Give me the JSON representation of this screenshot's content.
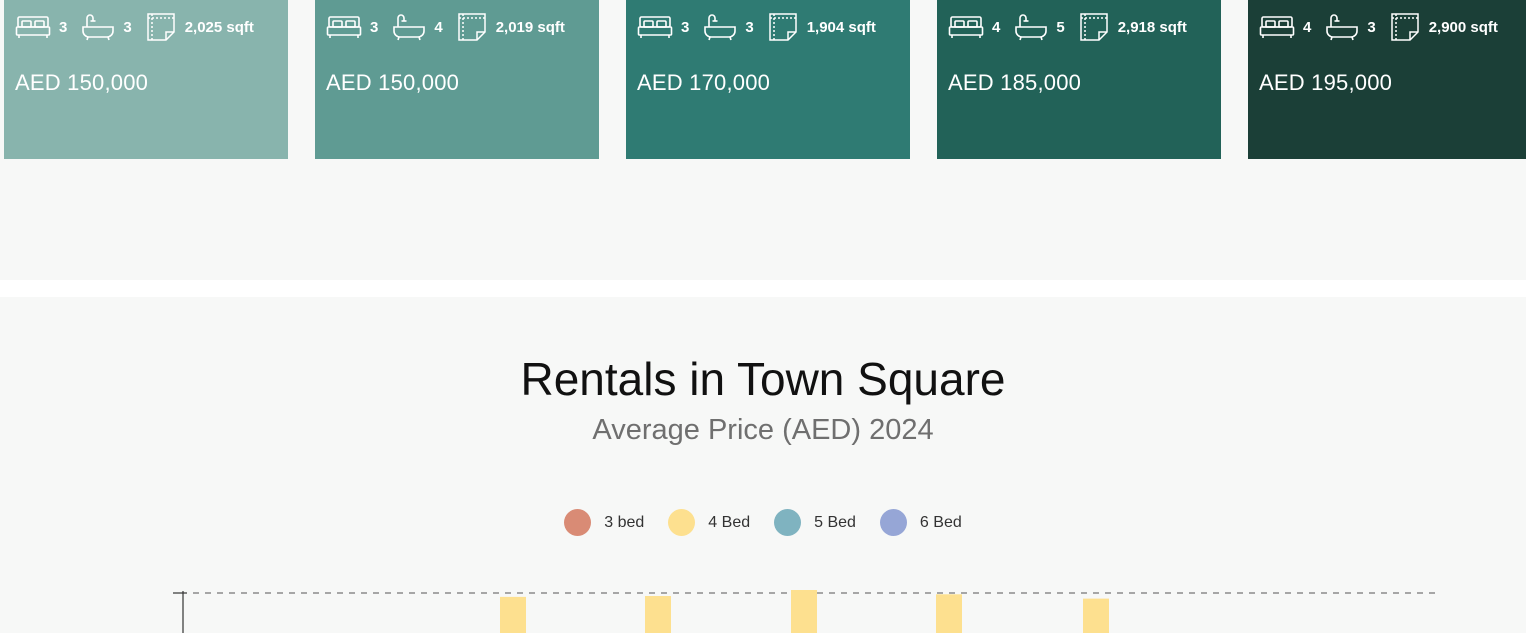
{
  "listings": [
    {
      "beds": "3",
      "baths": "3",
      "area": "2,025 sqft",
      "price": "AED 150,000",
      "color": "#88b4ad"
    },
    {
      "beds": "3",
      "baths": "4",
      "area": "2,019 sqft",
      "price": "AED 150,000",
      "color": "#5f9b93"
    },
    {
      "beds": "3",
      "baths": "3",
      "area": "1,904 sqft",
      "price": "AED 170,000",
      "color": "#2f7b73"
    },
    {
      "beds": "4",
      "baths": "5",
      "area": "2,918 sqft",
      "price": "AED 185,000",
      "color": "#226258"
    },
    {
      "beds": "4",
      "baths": "3",
      "area": "2,900 sqft",
      "price": "AED 195,000",
      "color": "#1b3f37"
    }
  ],
  "icons": {
    "beds": "bed-icon",
    "baths": "bathtub-icon",
    "area": "floor-plan-icon"
  },
  "chart": {
    "title": "Rentals in Town Square",
    "subtitle": "Average Price (AED) 2024"
  },
  "chart_data": {
    "type": "bar",
    "title": "Rentals in Town Square",
    "subtitle": "Average Price (AED) 2024",
    "legend": "top-center",
    "grid": true,
    "series": [
      {
        "name": "3 bed",
        "color": "#d98b75",
        "values": [
          null,
          null,
          null,
          null,
          null,
          null,
          null
        ]
      },
      {
        "name": "4 Bed",
        "color": "#fde08f",
        "values": [
          null,
          null,
          0.84,
          0.86,
          1.0,
          0.9,
          0.8
        ]
      },
      {
        "name": "5 Bed",
        "color": "#7fb3c0",
        "values": [
          null,
          null,
          null,
          null,
          null,
          null,
          null
        ]
      },
      {
        "name": "6 Bed",
        "color": "#96a6d6",
        "values": [
          null,
          null,
          null,
          null,
          null,
          null,
          null
        ]
      }
    ],
    "value_note_unit": "fraction of max visible value"
  }
}
